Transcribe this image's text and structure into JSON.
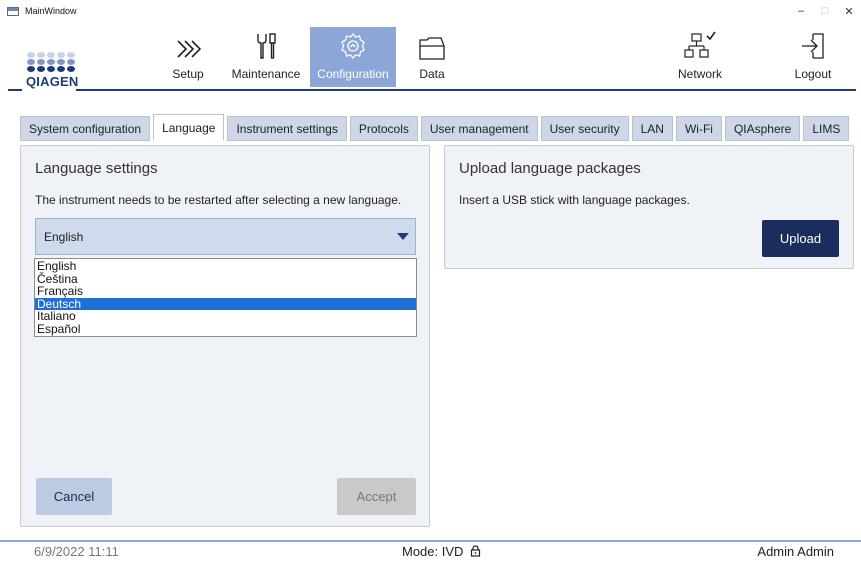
{
  "window": {
    "title": "MainWindow",
    "min_glyph": "–",
    "max_glyph": "□",
    "close_glyph": "✕"
  },
  "logo": {
    "text": "QIAGEN"
  },
  "nav": [
    {
      "label": "Setup",
      "icon": "chevrons-right-icon"
    },
    {
      "label": "Maintenance",
      "icon": "wrench-screwdriver-icon"
    },
    {
      "label": "Configuration",
      "icon": "gear-icon",
      "active": true
    },
    {
      "label": "Data",
      "icon": "folder-icon"
    },
    {
      "label": "Network",
      "icon": "network-check-icon"
    },
    {
      "label": "Logout",
      "icon": "logout-icon"
    }
  ],
  "tabs": [
    "System configuration",
    "Language",
    "Instrument settings",
    "Protocols",
    "User management",
    "User security",
    "LAN",
    "Wi-Fi",
    "QIAsphere",
    "LIMS"
  ],
  "active_tab": "Language",
  "language_panel": {
    "title": "Language settings",
    "note": "The instrument needs to be restarted after selecting a new language.",
    "selected_value": "English",
    "options": [
      "English",
      "Čeština",
      "Français",
      "Deutsch",
      "Italiano",
      "Español"
    ],
    "highlighted_option": "Deutsch",
    "cancel_label": "Cancel",
    "accept_label": "Accept"
  },
  "upload_panel": {
    "title": "Upload language packages",
    "note": "Insert a USB stick with language packages.",
    "upload_label": "Upload"
  },
  "status": {
    "datetime": "6/9/2022 11:11",
    "mode": "Mode: IVD",
    "mode_icon": "lock-icon",
    "user": "Admin Admin"
  },
  "colors": {
    "brand": "#1d3a7a",
    "nav_active": "#8ca6d8",
    "tab_bg": "#cdd7e8",
    "upload_button": "#1c2c5c",
    "selection": "#1f6fd6"
  }
}
